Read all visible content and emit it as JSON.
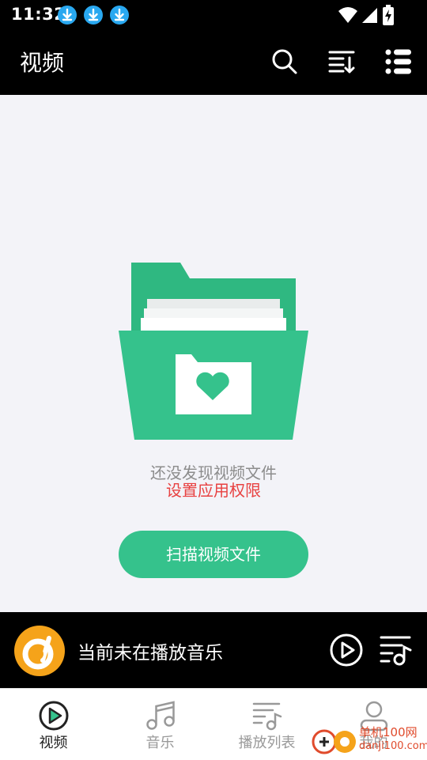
{
  "status_bar": {
    "time": "11:32",
    "download_icons": [
      "download-icon",
      "download-icon",
      "download-icon"
    ]
  },
  "app_bar": {
    "title": "视频",
    "actions": [
      "search-icon",
      "sort-icon",
      "menu-list-icon"
    ]
  },
  "empty_state": {
    "message": "还没发现视频文件",
    "permission_link": "设置应用权限",
    "scan_button": "扫描视频文件"
  },
  "player": {
    "now_playing": "当前未在播放音乐"
  },
  "bottom_nav": {
    "items": [
      {
        "label": "视频",
        "icon": "video-play-icon",
        "active": true
      },
      {
        "label": "音乐",
        "icon": "music-note-icon",
        "active": false
      },
      {
        "label": "播放列表",
        "icon": "playlist-icon",
        "active": false
      },
      {
        "label": "我的",
        "icon": "profile-icon",
        "active": false
      }
    ]
  },
  "watermark": {
    "brand": "单机100网",
    "domain": "danji100.com"
  },
  "colors": {
    "accent": "#35c28c",
    "link_red": "#e84141",
    "bar_bg": "#000000",
    "content_bg": "#f3f3f8"
  }
}
